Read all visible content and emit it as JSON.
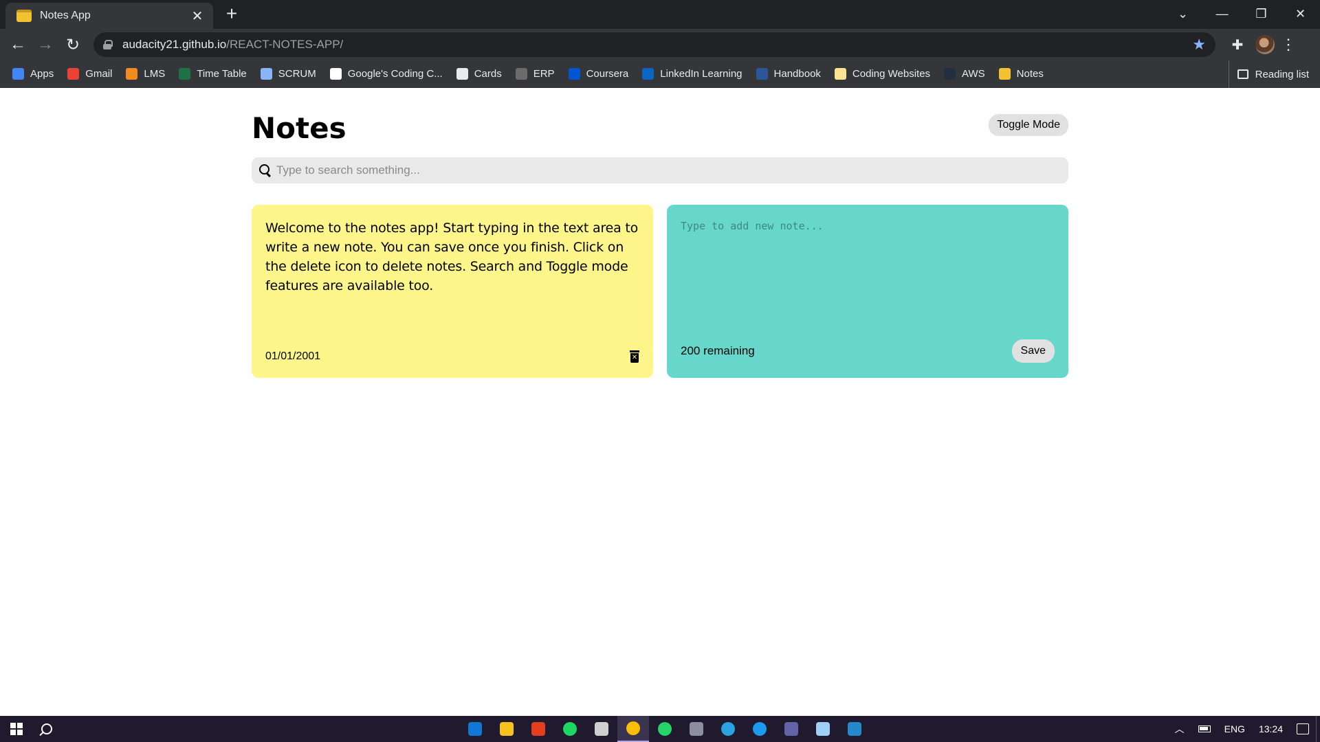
{
  "browser": {
    "tab_title": "Notes App",
    "url_host": "audacity21.github.io",
    "url_path": "/REACT-NOTES-APP/",
    "bookmarks": [
      {
        "label": "Apps",
        "icon": "apps-grid-icon",
        "color": "#4285f4"
      },
      {
        "label": "Gmail",
        "icon": "gmail-icon",
        "color": "#ea4335"
      },
      {
        "label": "LMS",
        "icon": "lms-icon",
        "color": "#f28b20"
      },
      {
        "label": "Time Table",
        "icon": "excel-icon",
        "color": "#1e7145"
      },
      {
        "label": "SCRUM",
        "icon": "document-icon",
        "color": "#8ab4f8"
      },
      {
        "label": "Google's Coding C...",
        "icon": "google-icon",
        "color": "#ffffff"
      },
      {
        "label": "Cards",
        "icon": "globe-icon",
        "color": "#e8eaed"
      },
      {
        "label": "ERP",
        "icon": "gear-icon",
        "color": "#6b6b6b"
      },
      {
        "label": "Coursera",
        "icon": "coursera-icon",
        "color": "#0056d2"
      },
      {
        "label": "LinkedIn Learning",
        "icon": "linkedin-learning-icon",
        "color": "#0a66c2"
      },
      {
        "label": "Handbook",
        "icon": "word-icon",
        "color": "#2b579a"
      },
      {
        "label": "Coding Websites",
        "icon": "folder-icon",
        "color": "#fde293"
      },
      {
        "label": "AWS",
        "icon": "aws-icon",
        "color": "#232f3e"
      },
      {
        "label": "Notes",
        "icon": "notes-icon",
        "color": "#f2c230"
      }
    ],
    "reading_list": "Reading list"
  },
  "app": {
    "title": "Notes",
    "toggle_label": "Toggle Mode",
    "search_placeholder": "Type to search something...",
    "notes": [
      {
        "text": "Welcome to the notes app! Start typing in the text area to write a new note. You can save once you finish. Click on the delete icon to delete notes. Search and Toggle mode features are available too.",
        "date": "01/01/2001",
        "color": "#fef68a"
      }
    ],
    "new_note": {
      "placeholder": "Type to add new note...",
      "remaining": "200 remaining",
      "save_label": "Save",
      "color": "#67d7cc"
    }
  },
  "taskbar": {
    "apps": [
      {
        "name": "mail-app-icon",
        "color": "#0f78d4"
      },
      {
        "name": "file-explorer-icon",
        "color": "#f8c21c"
      },
      {
        "name": "office-icon",
        "color": "#e43e1c"
      },
      {
        "name": "spotify-icon",
        "color": "#1ed760"
      },
      {
        "name": "settings-icon",
        "color": "#d0d0d0"
      },
      {
        "name": "chrome-icon",
        "color": "#fbbc04"
      },
      {
        "name": "whatsapp-icon",
        "color": "#25d366"
      },
      {
        "name": "disk-icon",
        "color": "#8e8ea0"
      },
      {
        "name": "telegram-icon",
        "color": "#2aa3e0"
      },
      {
        "name": "twitter-icon",
        "color": "#1d9bf0"
      },
      {
        "name": "teams-icon",
        "color": "#6264a7"
      },
      {
        "name": "notepad-icon",
        "color": "#9fd1f5"
      },
      {
        "name": "vscode-icon",
        "color": "#2489ca"
      }
    ],
    "language": "ENG",
    "time": "13:24"
  }
}
